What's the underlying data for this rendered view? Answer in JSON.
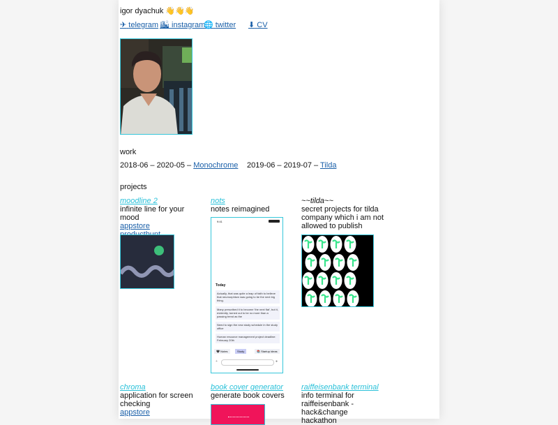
{
  "header": {
    "name": "igor dyachuk 👋👋👋"
  },
  "links": [
    {
      "icon": "✈",
      "label": "telegram"
    },
    {
      "icon": "🏙",
      "label": "instagram"
    },
    {
      "icon": "🌐",
      "label": "twitter"
    },
    {
      "icon": "⬇",
      "label": "CV"
    }
  ],
  "work": {
    "title": "work",
    "items": [
      {
        "dates": "2018-06 – 2020-05 – ",
        "company": "Monochrome"
      },
      {
        "dates": "2019-06 – 2019-07 – ",
        "company": "Tilda"
      }
    ]
  },
  "projects": {
    "title": "projects",
    "items": [
      {
        "name": "moodline 2",
        "desc": "infinite line for your mood",
        "links": [
          "appstore",
          "producthunt"
        ]
      },
      {
        "name": "nots",
        "desc": "notes reimagined",
        "links": []
      },
      {
        "name": "~~tilda~~",
        "desc": "secret projects for tilda company which i am not allowed to publish",
        "links": []
      },
      {
        "name": "chroma",
        "desc": "application for screen checking",
        "links": [
          "appstore"
        ]
      },
      {
        "name": "book cover generator",
        "desc": "generate book covers",
        "links": []
      },
      {
        "name": "raiffeisenbank terminal",
        "desc": "info terminal for raiffeisenbank - hack&change hackathon",
        "links": []
      }
    ]
  },
  "nots_screen": {
    "time": "9:41",
    "section": "Today",
    "notes": [
      "Actually, that was quite a leap of faith to believe that neumorphism was going to be the next big thing.",
      "Many prescribed it to become 'the next flat', but it, evidently, turned out to be no more than a passing trend as the",
      "Need to sign the new study schedule in the study office",
      "Human resource management project deadline: February 20th"
    ],
    "tabs": [
      "🖤 Notes",
      "Study",
      "📚 Startup ideas"
    ]
  },
  "colors": {
    "accent": "#2ac1d9",
    "link": "#1a5fa8",
    "moodline_bg": "#272c3c",
    "moodline_wave": "#9096b4",
    "moodline_dot": "#3dbf7a",
    "tilda_green": "#39e58c",
    "book_cover": "#f0145a"
  }
}
